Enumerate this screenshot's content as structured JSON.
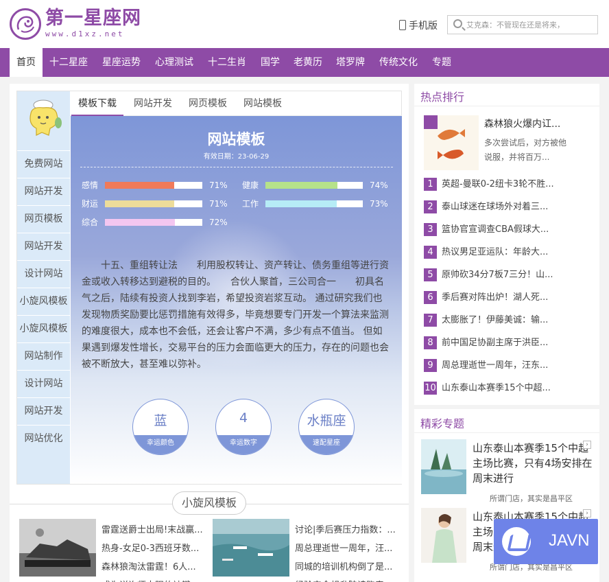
{
  "header": {
    "logo_text": "第一星座网",
    "logo_url": "www.d1xz.net",
    "mobile_label": "手机版",
    "search_placeholder": "艾克森：不管现在还是将来，"
  },
  "nav": {
    "items": [
      "首页",
      "十二星座",
      "星座运势",
      "心理测试",
      "十二生肖",
      "国学",
      "老黄历",
      "塔罗牌",
      "传统文化",
      "专题"
    ],
    "active_index": 0
  },
  "sidebar": {
    "items": [
      "免费网站",
      "网站开发",
      "网页模板",
      "网站开发",
      "设计网站",
      "小旋风模板",
      "小旋风模板",
      "网站制作",
      "设计网站",
      "网站开发",
      "网站优化"
    ]
  },
  "tabs": [
    "模板下载",
    "网站开发",
    "网页模板",
    "网站模板"
  ],
  "panel": {
    "title": "网站模板",
    "date": "有效日期：23-06-29",
    "bars": [
      {
        "label": "感情",
        "percent": 71,
        "pct_text": "71%",
        "color": "#f07a5a"
      },
      {
        "label": "健康",
        "percent": 74,
        "pct_text": "74%",
        "color": "#b6e28a"
      },
      {
        "label": "财运",
        "percent": 71,
        "pct_text": "71%",
        "color": "#eddc9a"
      },
      {
        "label": "工作",
        "percent": 73,
        "pct_text": "73%",
        "color": "#b6ecf6"
      },
      {
        "label": "综合",
        "percent": 72,
        "pct_text": "72%",
        "color": "#f3c6f0"
      }
    ],
    "text": "十五、重组转让法　　利用股权转让、资产转让、债务重组等进行资金或收入转移达到避税的目的。　　合伙人聚首，三公司合一　　初具名气之后，陆续有投资人找到李岩，希望投资岩浆互动。 通过研究我们也发现物质奖励要比惩罚措施有效得多，毕竟想要专门开发一个算法来监测的难度很大，成本也不会低，还会让客户不满，多少有点不值当。 但如果遇到爆发性增长，交易平台的压力会面临更大的压力，存在的问题也会被不断放大，甚至难以弥补。",
    "lucky": [
      {
        "value": "蓝",
        "key": "幸运颜色"
      },
      {
        "value": "4",
        "key": "幸运数字"
      },
      {
        "value": "水瓶座",
        "key": "速配星座"
      }
    ]
  },
  "section": {
    "title": "小旋风模板",
    "list1": [
      "雷霆送爵士出局!末战赢...",
      "热身-女足0-3西班牙数...",
      "森林狼淘汰雷霆！6人...",
      "成为详询师大阳的被键..."
    ],
    "list2": [
      "讨论|季后赛压力指数：...",
      "周总理逝世一周年，汪...",
      "同城的培训机构倒了是...",
      "经验安全想升陆读跑春..."
    ]
  },
  "hot": {
    "title": "热点排行",
    "featured_title": "森林狼火爆内讧...",
    "featured_desc": "多次尝试后，对方被他说服，并将百万...",
    "items": [
      {
        "num": "1",
        "text": "英超-曼联0-2纽卡3轮不胜..."
      },
      {
        "num": "2",
        "text": "泰山球迷在球场外对着三..."
      },
      {
        "num": "3",
        "text": "篮协官宣调查CBA假球大..."
      },
      {
        "num": "4",
        "text": "热议男足亚运队：年龄大..."
      },
      {
        "num": "5",
        "text": "原帅砍34分7板7三分！山..."
      },
      {
        "num": "6",
        "text": "季后赛对阵出炉！湖人死..."
      },
      {
        "num": "7",
        "text": "太膨胀了！伊藤美诚：输..."
      },
      {
        "num": "8",
        "text": "前中国足协副主席于洪臣..."
      },
      {
        "num": "9",
        "text": "周总理逝世一周年，汪东..."
      },
      {
        "num": "10",
        "text": "山东泰山本赛季15个中超..."
      }
    ]
  },
  "special": {
    "title": "精彩专题",
    "items": [
      {
        "title": "山东泰山本赛季15个中超主场比赛，只有4场安排在周末进行",
        "sub": "所谓门店，其实是昌平区"
      },
      {
        "title": "山东泰山本赛季15个中超主场比赛，只有4场安排在周末进行",
        "sub": "所谓门店，其实是昌平区"
      }
    ]
  },
  "watermark": {
    "text": "JAVN"
  },
  "colors": {
    "brand": "#8e4ba6",
    "panel": "#7e96d8",
    "sidebar": "#dbeaf8"
  }
}
